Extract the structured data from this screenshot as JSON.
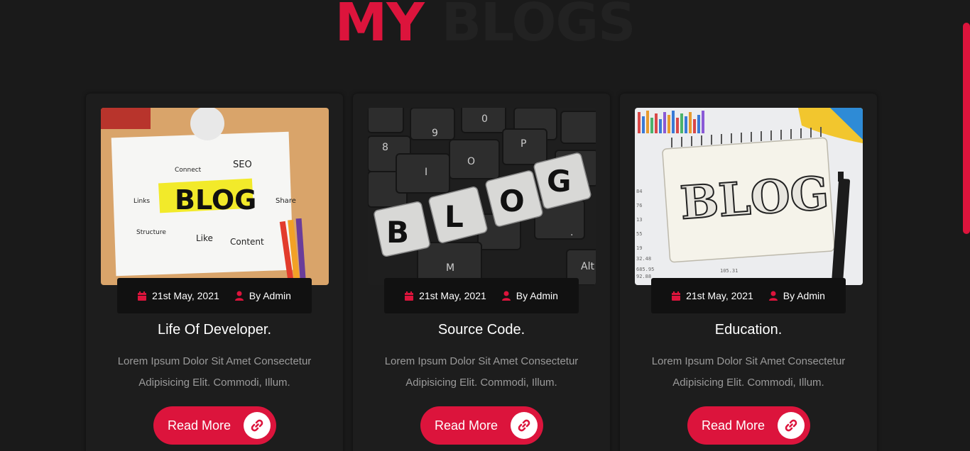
{
  "heading": {
    "word1": "MY",
    "word2": "BLOGS"
  },
  "colors": {
    "accent": "#dc143c",
    "background": "#1a1a1a",
    "card": "#1d1d1d",
    "meta_bg": "#111111"
  },
  "icons": {
    "date": "calendar-icon",
    "author": "user-icon",
    "link": "link-icon"
  },
  "posts": [
    {
      "image": "blog-concept-notebook-photo",
      "image_text": "BLOG",
      "date": "21st May, 2021",
      "author": "By Admin",
      "title": "Life Of Developer.",
      "desc_line1": "Lorem Ipsum Dolor Sit Amet Consectetur",
      "desc_line2": "Adipisicing Elit. Commodi, Illum.",
      "button": "Read More"
    },
    {
      "image": "keyboard-blog-keys-photo",
      "image_text": "BLOG",
      "date": "21st May, 2021",
      "author": "By Admin",
      "title": "Source Code.",
      "desc_line1": "Lorem Ipsum Dolor Sit Amet Consectetur",
      "desc_line2": "Adipisicing Elit. Commodi, Illum.",
      "button": "Read More"
    },
    {
      "image": "notepad-blog-marker-photo",
      "image_text": "BLOG",
      "date": "21st May, 2021",
      "author": "By Admin",
      "title": "Education.",
      "desc_line1": "Lorem Ipsum Dolor Sit Amet Consectetur",
      "desc_line2": "Adipisicing Elit. Commodi, Illum.",
      "button": "Read More"
    }
  ]
}
